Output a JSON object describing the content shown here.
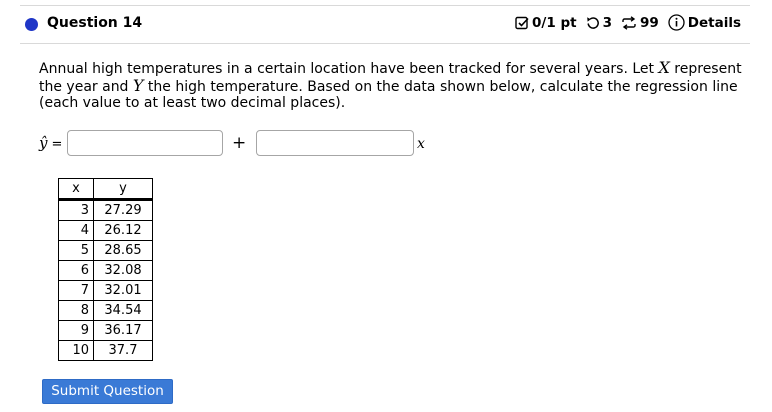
{
  "question": {
    "title": "Question 14",
    "score": "0/1 pt",
    "attempts": "3",
    "submissions": "99",
    "details_label": "Details",
    "status_color": "#1f36c7"
  },
  "prompt": {
    "part1": "Annual high temperatures in a certain location have been tracked for several years. Let ",
    "var_x": "X",
    "part2": " represent the year and ",
    "var_y": "Y",
    "part3": " the high temperature. Based on the data shown below, calculate the regression line (each value to at least two decimal places)."
  },
  "answer": {
    "lhs": "ŷ",
    "equals": "=",
    "intercept_value": "",
    "plus": "+",
    "slope_value": "",
    "variable": "x"
  },
  "table": {
    "headers": [
      "x",
      "y"
    ],
    "rows": [
      [
        "3",
        "27.29"
      ],
      [
        "4",
        "26.12"
      ],
      [
        "5",
        "28.65"
      ],
      [
        "6",
        "32.08"
      ],
      [
        "7",
        "32.01"
      ],
      [
        "8",
        "34.54"
      ],
      [
        "9",
        "36.17"
      ],
      [
        "10",
        "37.7"
      ]
    ]
  },
  "submit_label": "Submit Question",
  "accent_color": "#3a7ad6"
}
